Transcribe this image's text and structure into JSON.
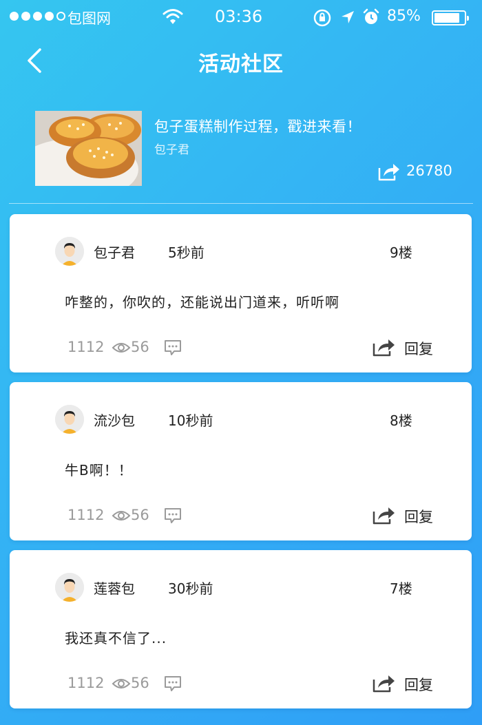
{
  "status_bar": {
    "carrier": "包图网",
    "time": "03:36",
    "battery": "85%",
    "battery_level": 0.85
  },
  "nav": {
    "title": "活动社区"
  },
  "post": {
    "title": "包子蛋糕制作过程，戳进来看！",
    "author": "包子君",
    "share_count": "26780"
  },
  "comments": [
    {
      "username": "包子君",
      "time": "5秒前",
      "floor": "9楼",
      "text": "咋整的，你吹的，还能说出门道来，听听啊",
      "likes": "1112",
      "views": "56",
      "reply_label": "回复"
    },
    {
      "username": "流沙包",
      "time": "10秒前",
      "floor": "8楼",
      "text": "牛B啊！！",
      "likes": "1112",
      "views": "56",
      "reply_label": "回复"
    },
    {
      "username": "莲蓉包",
      "time": "30秒前",
      "floor": "7楼",
      "text": "我还真不信了...",
      "likes": "1112",
      "views": "56",
      "reply_label": "回复"
    }
  ]
}
